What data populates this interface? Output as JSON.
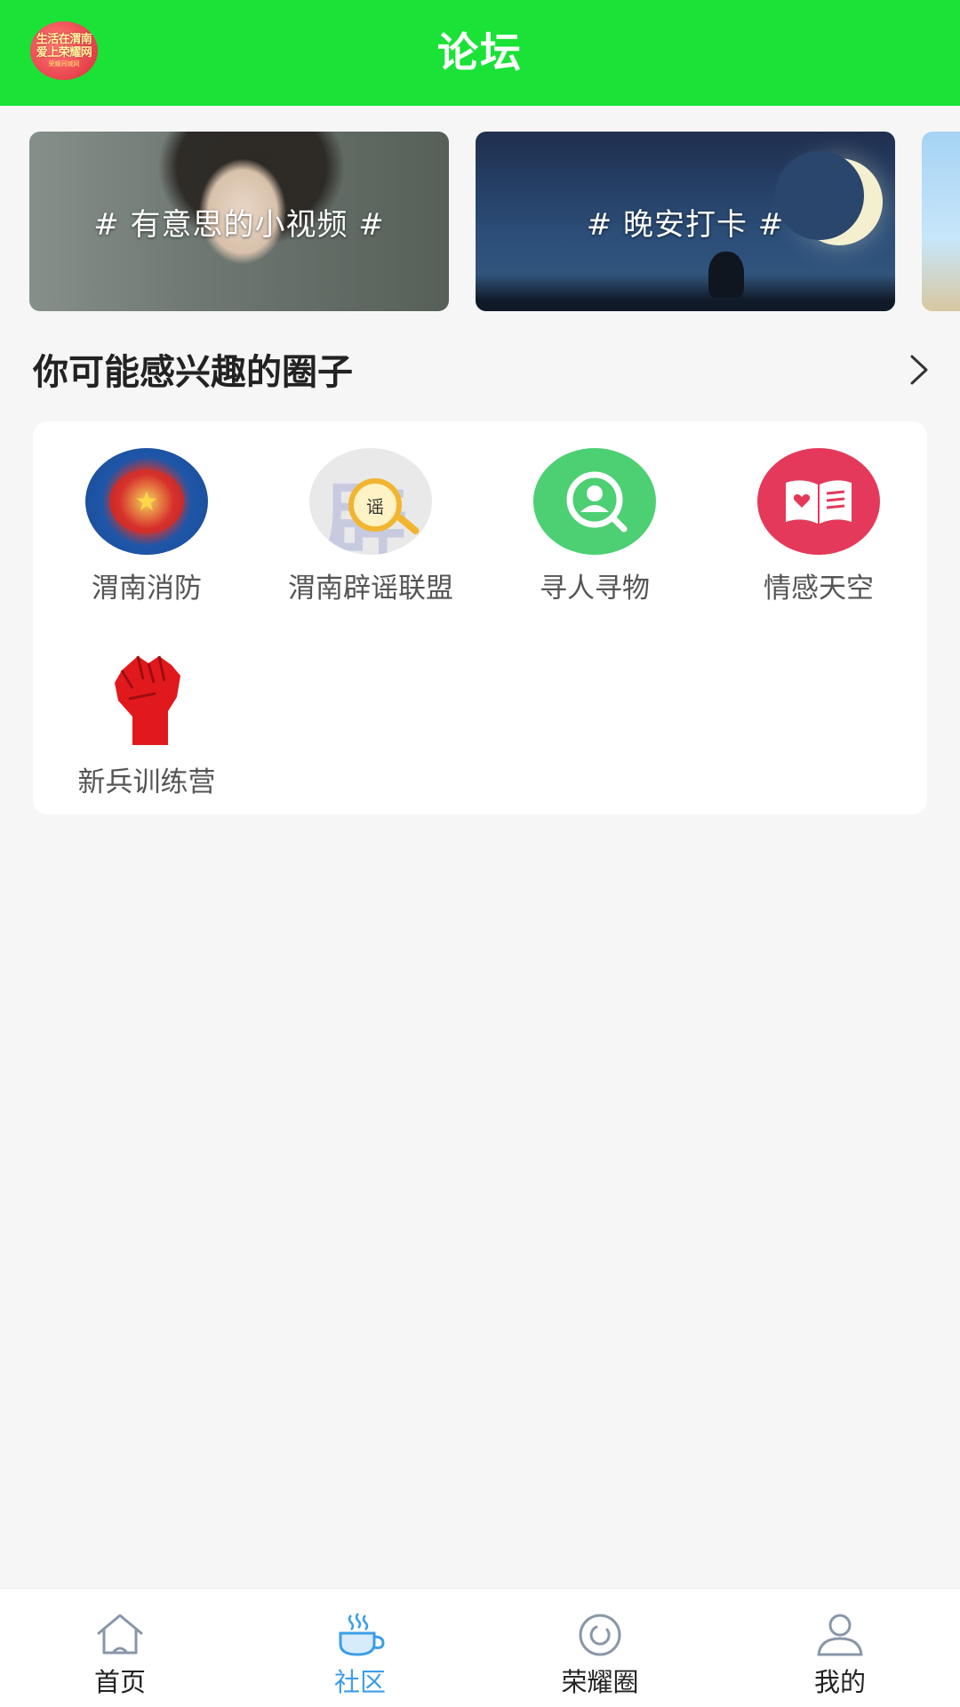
{
  "header": {
    "title": "论坛",
    "logo_line1": "生活在渭南",
    "logo_line2": "爱上荣耀网",
    "logo_line3": "荣耀同城网"
  },
  "banners": [
    {
      "label": "# 有意思的小视频 #"
    },
    {
      "label": "# 晚安打卡 #"
    }
  ],
  "section": {
    "title": "你可能感兴趣的圈子"
  },
  "circles": [
    {
      "label": "渭南消防",
      "icon": "fire-rescue-emblem-icon"
    },
    {
      "label": "渭南辟谣联盟",
      "icon": "rumor-magnifier-icon",
      "glyph_big": "辟",
      "glyph_small": "谣"
    },
    {
      "label": "寻人寻物",
      "icon": "person-search-icon"
    },
    {
      "label": "情感天空",
      "icon": "heart-book-icon"
    },
    {
      "label": "新兵训练营",
      "icon": "raised-fist-icon"
    }
  ],
  "tabbar": {
    "items": [
      {
        "label": "首页",
        "icon": "home-icon"
      },
      {
        "label": "社区",
        "icon": "coffee-cup-icon",
        "active": true
      },
      {
        "label": "荣耀圈",
        "icon": "circle-refresh-icon"
      },
      {
        "label": "我的",
        "icon": "user-icon"
      }
    ]
  },
  "colors": {
    "header_green": "#1be237",
    "active_tab_blue": "#3b9ee8"
  }
}
